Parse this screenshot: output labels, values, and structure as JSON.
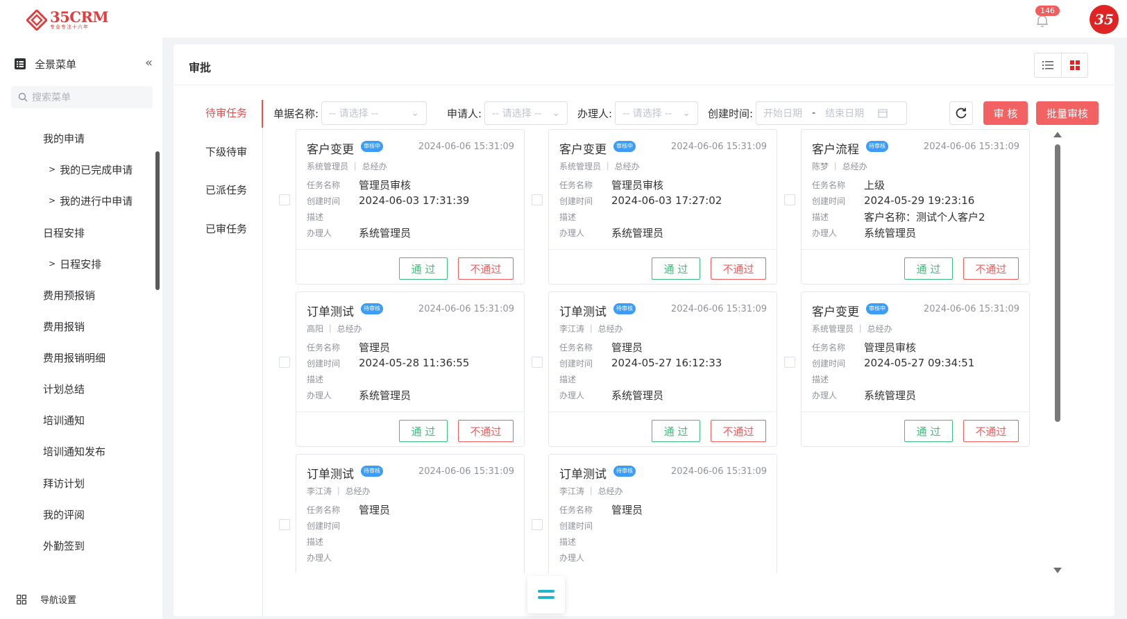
{
  "brand": {
    "name": "35CRM",
    "slogan": "专业专注十六年",
    "color": "#e23d3d"
  },
  "header": {
    "notification_count": "146"
  },
  "sidebar": {
    "menu_title": "全景菜单",
    "search_placeholder": "搜索菜单",
    "items": [
      {
        "label": "我的申请",
        "child": false
      },
      {
        "label": "我的已完成申请",
        "child": true
      },
      {
        "label": "我的进行中申请",
        "child": true
      },
      {
        "label": "日程安排",
        "child": false
      },
      {
        "label": "日程安排",
        "child": true
      },
      {
        "label": "费用预报销",
        "child": false
      },
      {
        "label": "费用报销",
        "child": false
      },
      {
        "label": "费用报销明细",
        "child": false
      },
      {
        "label": "计划总结",
        "child": false
      },
      {
        "label": "培训通知",
        "child": false
      },
      {
        "label": "培训通知发布",
        "child": false
      },
      {
        "label": "拜访计划",
        "child": false
      },
      {
        "label": "我的评阅",
        "child": false
      },
      {
        "label": "外勤签到",
        "child": false
      }
    ],
    "nav_setting": "导航设置"
  },
  "main": {
    "title": "审批",
    "tabs": [
      "待审任务",
      "下级待审",
      "已派任务",
      "已审任务"
    ],
    "active_tab": 0,
    "filters": {
      "doc_name_label": "单据名称:",
      "doc_name_placeholder": "-- 请选择 --",
      "applicant_label": "申请人:",
      "applicant_placeholder": "-- 请选择 --",
      "handler_label": "办理人:",
      "handler_placeholder": "-- 请选择 --",
      "created_label": "创建时间:",
      "start_placeholder": "开始日期",
      "range_sep": "-",
      "end_placeholder": "结束日期"
    },
    "buttons": {
      "review": "审 核",
      "batch_review": "批量审核"
    },
    "field_labels": {
      "task": "任务名称",
      "created": "创建时间",
      "desc": "描述",
      "handler": "办理人"
    },
    "actions": {
      "pass": "通 过",
      "fail": "不通过"
    },
    "cards": [
      {
        "title": "客户变更",
        "tag": "审核中",
        "time": "2024-06-06 15:31:09",
        "applicant": "系统管理员",
        "dept": "总经办",
        "task": "管理员审核",
        "created": "2024-06-03 17:31:39",
        "desc": "",
        "handler": "系统管理员"
      },
      {
        "title": "客户变更",
        "tag": "审核中",
        "time": "2024-06-06 15:31:09",
        "applicant": "系统管理员",
        "dept": "总经办",
        "task": "管理员审核",
        "created": "2024-06-03 17:27:02",
        "desc": "",
        "handler": "系统管理员"
      },
      {
        "title": "客户流程",
        "tag": "待审核",
        "time": "2024-06-06 15:31:09",
        "applicant": "陈梦",
        "dept": "总经办",
        "task": "上级",
        "created": "2024-05-29 19:23:16",
        "desc": "客户名称：测试个人客户2",
        "handler": "系统管理员"
      },
      {
        "title": "订单测试",
        "tag": "待审核",
        "time": "2024-06-06 15:31:09",
        "applicant": "高阳",
        "dept": "总经办",
        "task": "管理员",
        "created": "2024-05-28 11:36:55",
        "desc": "",
        "handler": "系统管理员"
      },
      {
        "title": "订单测试",
        "tag": "待审核",
        "time": "2024-06-06 15:31:09",
        "applicant": "李江涛",
        "dept": "总经办",
        "task": "管理员",
        "created": "2024-05-27 16:12:33",
        "desc": "",
        "handler": "系统管理员"
      },
      {
        "title": "客户变更",
        "tag": "审核中",
        "time": "2024-06-06 15:31:09",
        "applicant": "系统管理员",
        "dept": "总经办",
        "task": "管理员审核",
        "created": "2024-05-27 09:34:51",
        "desc": "",
        "handler": "系统管理员"
      },
      {
        "title": "订单测试",
        "tag": "待审核",
        "time": "2024-06-06 15:31:09",
        "applicant": "李江涛",
        "dept": "总经办",
        "task": "管理员",
        "created": "",
        "desc": "",
        "handler": ""
      },
      {
        "title": "订单测试",
        "tag": "待审核",
        "time": "2024-06-06 15:31:09",
        "applicant": "李江涛",
        "dept": "总经办",
        "task": "管理员",
        "created": "",
        "desc": "",
        "handler": ""
      }
    ]
  },
  "colors": {
    "accent_red": "#f36262",
    "pass_green": "#3bbf7a",
    "tag_blue": "#3c9cf6"
  }
}
